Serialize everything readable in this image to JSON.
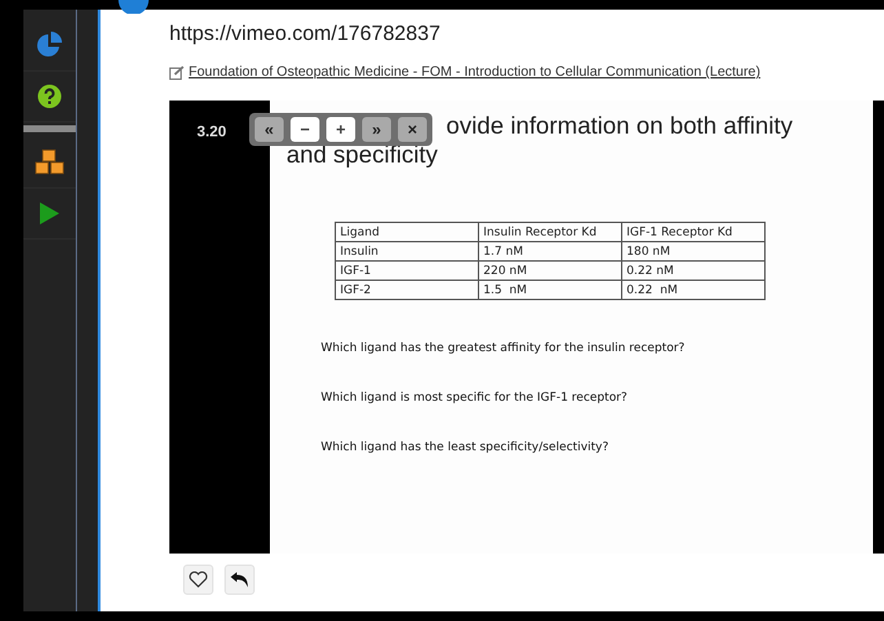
{
  "url": "https://vimeo.com/176782837",
  "link": "Foundation of Osteopathic Medicine - FOM - Introduction to Cellular Communication (Lecture)",
  "slide": {
    "number": "3.20",
    "title_lines": [
      "ovide information on both affinity",
      "and specificity"
    ],
    "table": {
      "columns": [
        "Ligand",
        "Insulin Receptor Kd",
        "IGF-1 Receptor Kd"
      ],
      "rows": [
        [
          "Insulin",
          "1.7 nM",
          "180 nM"
        ],
        [
          "IGF-1",
          "220 nM",
          "0.22 nM"
        ],
        [
          "IGF-2",
          "1.5  nM",
          "0.22  nM"
        ]
      ]
    },
    "questions": [
      "Which ligand has the greatest affinity for the insulin receptor?",
      "Which ligand is most specific for the IGF-1 receptor?",
      "Which ligand has the least specificity/selectivity?"
    ]
  },
  "overlay_buttons": [
    {
      "label": "«",
      "highlighted": false
    },
    {
      "label": "−",
      "highlighted": true
    },
    {
      "label": "+",
      "highlighted": true
    },
    {
      "label": "»",
      "highlighted": false
    },
    {
      "label": "×",
      "highlighted": false
    }
  ],
  "sidebar": [
    {
      "kind": "chart"
    },
    {
      "kind": "help"
    },
    {
      "kind": "divider"
    },
    {
      "kind": "boxes"
    },
    {
      "kind": "play"
    }
  ]
}
